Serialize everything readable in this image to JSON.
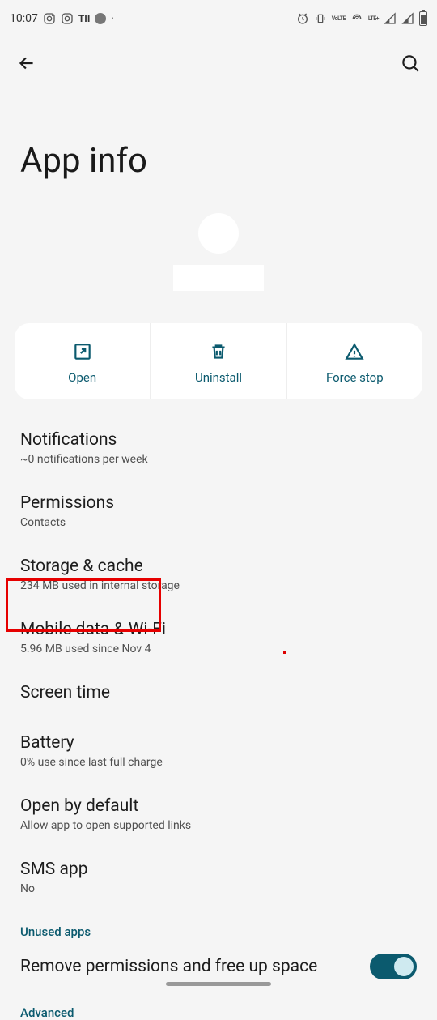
{
  "statusbar": {
    "time": "10:07",
    "notif_txt": "TII",
    "lte": "LTE+",
    "volte": "VoLTE"
  },
  "appbar": {
    "back": "Back",
    "search": "Search"
  },
  "title": "App info",
  "actions": {
    "open": "Open",
    "uninstall": "Uninstall",
    "force_stop": "Force stop"
  },
  "items": {
    "notifications": {
      "title": "Notifications",
      "sub": "~0 notifications per week"
    },
    "permissions": {
      "title": "Permissions",
      "sub": "Contacts"
    },
    "storage": {
      "title": "Storage & cache",
      "sub": "234 MB used in internal storage"
    },
    "mobile_data": {
      "title": "Mobile data & Wi-Fi",
      "sub": "5.96 MB used since Nov 4"
    },
    "screen_time": {
      "title": "Screen time",
      "sub": ""
    },
    "battery": {
      "title": "Battery",
      "sub": "0% use since last full charge"
    },
    "open_default": {
      "title": "Open by default",
      "sub": "Allow app to open supported links"
    },
    "sms_app": {
      "title": "SMS app",
      "sub": "No"
    }
  },
  "section_unused": "Unused apps",
  "toggle_remove": "Remove permissions and free up space",
  "advanced": "Advanced"
}
